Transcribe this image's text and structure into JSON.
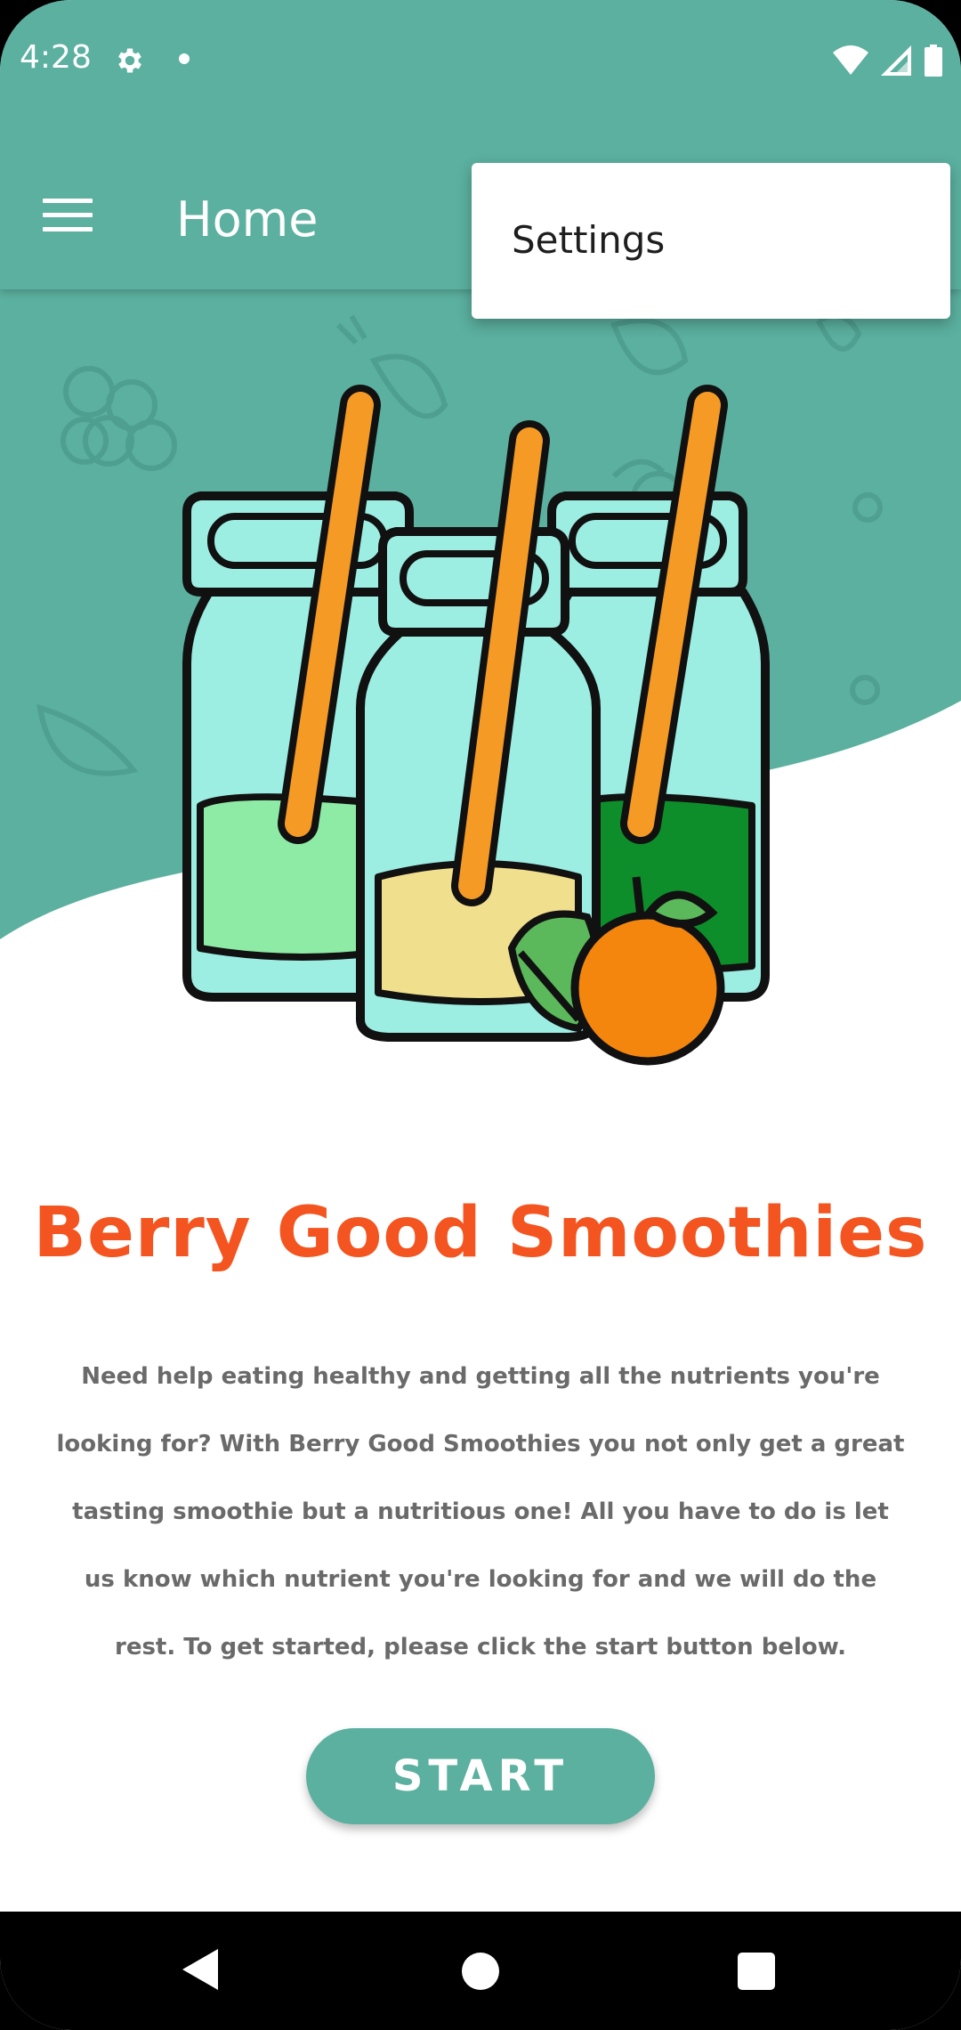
{
  "status_bar": {
    "time": "4:28",
    "icons": [
      "gear-icon",
      "notification-dot",
      "wifi-icon",
      "signal-icon",
      "battery-icon"
    ]
  },
  "toolbar": {
    "title": "Home",
    "menu_icon": "hamburger-menu-icon"
  },
  "overflow_menu": {
    "items": [
      {
        "label": "Settings"
      }
    ]
  },
  "main": {
    "app_title": "Berry Good Smoothies",
    "description": "Need help eating healthy and getting all the nutrients you're looking for? With Berry Good Smoothies you not only get a great tasting smoothie but a nutritious one! All you have to do is let us know which nutrient you're looking for and we will do the rest. To get started, please click the start button below.",
    "start_label": "START"
  },
  "nav_bar": {
    "icons": [
      "back-icon",
      "home-icon",
      "recents-icon"
    ]
  },
  "colors": {
    "accent": "#5BB09F",
    "title": "#F4541F",
    "body_text": "#6A6A6A"
  }
}
